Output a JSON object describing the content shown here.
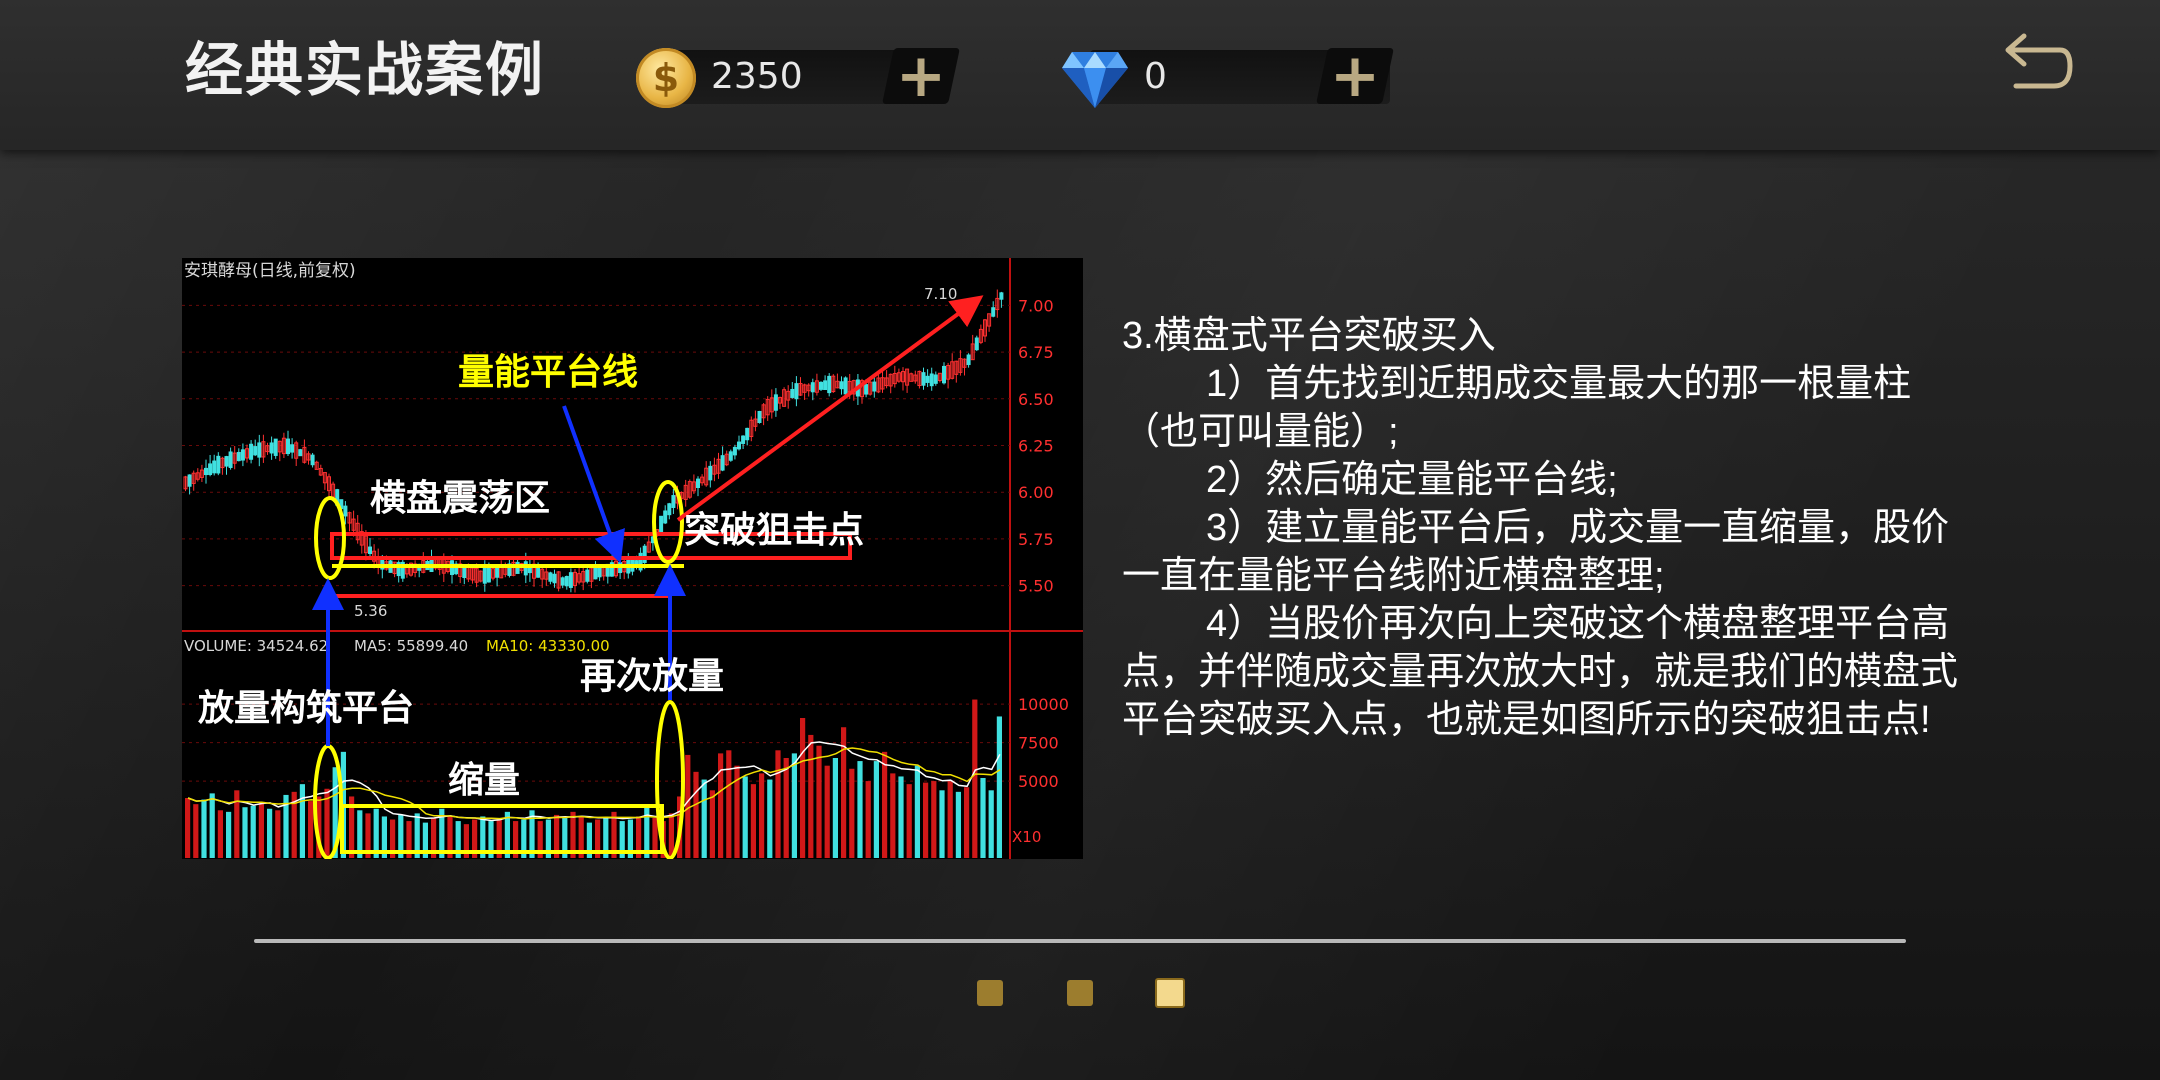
{
  "header": {
    "title": "经典实战案例",
    "coins": {
      "value": "2350",
      "icon": "coin-icon",
      "glyph": "$",
      "add": "+"
    },
    "gems": {
      "value": "0",
      "icon": "gem-icon",
      "add": "+"
    },
    "back": {
      "icon": "back-arrow-icon"
    }
  },
  "chart": {
    "stock_label": "安琪酵母(日线,前复权)",
    "price_ticks": [
      "7.00",
      "6.75",
      "6.50",
      "6.25",
      "6.00",
      "5.75",
      "5.50"
    ],
    "peak_label": "7.10",
    "low_label": "5.36",
    "volume_info": {
      "volume": "VOLUME: 34524.62",
      "ma5": "MA5: 55899.40",
      "ma10": "MA10: 43330.00"
    },
    "volume_ticks": [
      "10000",
      "7500",
      "5000"
    ],
    "volume_unit": "X10",
    "annotations": {
      "platform_line": "量能平台线",
      "consolidation": "横盘震荡区",
      "breakout": "突破狙击点",
      "build_platform": "放量构筑平台",
      "shrink": "缩量",
      "increase_again": "再次放量"
    }
  },
  "explanation": {
    "heading": "3.横盘式平台突破买入",
    "items": [
      "1）首先找到近期成交量最大的那一根量柱（也可叫量能）;",
      "2）然后确定量能平台线;",
      "3）建立量能平台后，成交量一直缩量，股价一直在量能平台线附近横盘整理;",
      "4）当股价再次向上突破这个横盘整理平台高点，并伴随成交量再次放大时，就是我们的横盘式平台突破买入点，也就是如图所示的突破狙击点!"
    ]
  },
  "pager": {
    "count": 3,
    "active_index": 2
  },
  "colors": {
    "gold": "#c8a24a",
    "chart_red": "#ff2020",
    "chart_cyan": "#40e0e0",
    "annotation_yellow": "#ffff00",
    "arrow_blue": "#1030ff"
  },
  "chart_data": {
    "type": "candlestick",
    "title": "安琪酵母(日线,前复权)",
    "price_axis": {
      "ticks": [
        7.0,
        6.75,
        6.5,
        6.25,
        6.0,
        5.75,
        5.5
      ],
      "ylim": [
        5.3,
        7.2
      ]
    },
    "price_path": [
      [
        0,
        6.05
      ],
      [
        8,
        6.15
      ],
      [
        16,
        6.22
      ],
      [
        24,
        6.25
      ],
      [
        30,
        6.18
      ],
      [
        34,
        6.05
      ],
      [
        38,
        5.9
      ],
      [
        42,
        5.75
      ],
      [
        46,
        5.62
      ],
      [
        52,
        5.58
      ],
      [
        60,
        5.62
      ],
      [
        70,
        5.55
      ],
      [
        80,
        5.6
      ],
      [
        90,
        5.52
      ],
      [
        100,
        5.58
      ],
      [
        108,
        5.62
      ],
      [
        112,
        5.78
      ],
      [
        116,
        5.95
      ],
      [
        122,
        6.05
      ],
      [
        130,
        6.2
      ],
      [
        138,
        6.45
      ],
      [
        146,
        6.55
      ],
      [
        154,
        6.58
      ],
      [
        162,
        6.55
      ],
      [
        170,
        6.62
      ],
      [
        178,
        6.6
      ],
      [
        186,
        6.7
      ],
      [
        194,
        7.05
      ]
    ],
    "platform_high": 5.78,
    "platform_low": 5.44,
    "peak": 7.1,
    "low": 5.36,
    "volume_axis": {
      "ticks": [
        10000,
        7500,
        5000
      ]
    },
    "volume_bars": [
      3900,
      3500,
      3800,
      4200,
      3100,
      3000,
      4400,
      3300,
      3400,
      3600,
      3200,
      3100,
      4100,
      4300,
      4800,
      3700,
      4000,
      4500,
      5900,
      6900,
      4000,
      3100,
      2900,
      3200,
      2700,
      2500,
      2800,
      2400,
      2900,
      2300,
      2600,
      3200,
      2700,
      2400,
      2200,
      2500,
      2700,
      2400,
      2600,
      3000,
      2400,
      2500,
      3100,
      2400,
      2500,
      2800,
      2600,
      3000,
      2700,
      2300,
      2500,
      2600,
      3000,
      2400,
      2500,
      2700,
      3300,
      2600,
      2400,
      2900,
      4000,
      6700,
      5600,
      5100,
      4400,
      6800,
      7000,
      6000,
      5300,
      4800,
      5500,
      5100,
      7000,
      6500,
      6800,
      9100,
      8000,
      7300,
      6000,
      6500,
      8500,
      5800,
      6300,
      5000,
      6300,
      6900,
      5500,
      5300,
      4800,
      6000,
      4900,
      5000,
      4400,
      5000,
      4300,
      4600,
      10300,
      5200,
      4400,
      9200
    ],
    "bar_up_flags": "rrccrcrccrcrcrcrrrccrcrccrcrccrcrcrrccrcrccrcrcrrcrcrccrcrrrrrrcrrrrcrrcrrcrrrrcrrcrcrrcrcrrcrcrr"
  }
}
